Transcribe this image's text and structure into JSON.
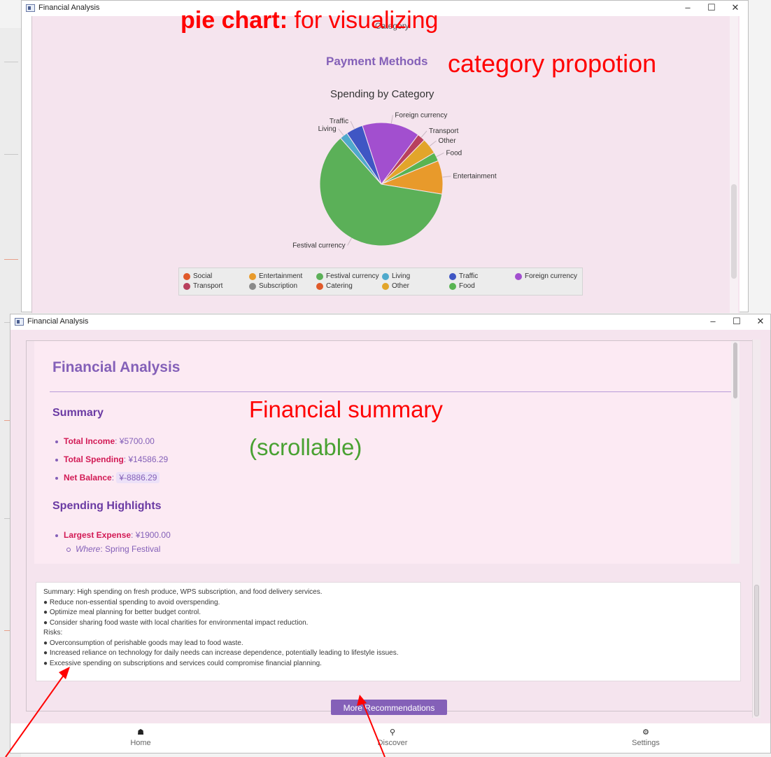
{
  "window1": {
    "title": "Financial Analysis",
    "minimize": "–",
    "maximize": "☐",
    "close": "✕",
    "cut_label": "Category",
    "payment_methods": "Payment Methods"
  },
  "annotations": {
    "pie_label": "pie chart:",
    "pie_desc": " for visualizing",
    "pie_desc2": "category propotion",
    "summary_a": "Financial summary",
    "summary_b": "(scrollable)"
  },
  "chart_data": {
    "type": "pie",
    "title": "Spending by Category",
    "slices": [
      {
        "label": "Foreign currency",
        "value": 1900,
        "color": "#a24fcf"
      },
      {
        "label": "Transport",
        "value": 260,
        "color": "#b8405e"
      },
      {
        "label": "Other",
        "value": 520,
        "color": "#e2a52a"
      },
      {
        "label": "Food",
        "value": 290,
        "color": "#58b452"
      },
      {
        "label": "Entertainment",
        "value": 1100,
        "color": "#e89a2b"
      },
      {
        "label": "Festival currency",
        "value": 7600,
        "color": "#5bb058"
      },
      {
        "label": "Living",
        "value": 260,
        "color": "#4fa9cc"
      },
      {
        "label": "Traffic",
        "value": 556,
        "color": "#3f56c4"
      }
    ],
    "legend": [
      {
        "label": "Social",
        "color": "#e05a2a"
      },
      {
        "label": "Entertainment",
        "color": "#e89a2b"
      },
      {
        "label": "Festival currency",
        "color": "#5bb058"
      },
      {
        "label": "Living",
        "color": "#4fa9cc"
      },
      {
        "label": "Traffic",
        "color": "#3f56c4"
      },
      {
        "label": "Foreign currency",
        "color": "#a24fcf"
      },
      {
        "label": "Transport",
        "color": "#b8405e"
      },
      {
        "label": "Subscription",
        "color": "#8a8a8a"
      },
      {
        "label": "Catering",
        "color": "#e05a2a"
      },
      {
        "label": "Other",
        "color": "#e2a52a"
      },
      {
        "label": "Food",
        "color": "#58b452"
      }
    ]
  },
  "window2": {
    "title": "Financial Analysis",
    "minimize": "–",
    "maximize": "☐",
    "close": "✕"
  },
  "report": {
    "title": "Financial Analysis",
    "summary_heading": "Summary",
    "income_label": "Total Income",
    "income_value": ": ¥5700.00",
    "spending_label": "Total Spending",
    "spending_value": ": ¥14586.29",
    "net_label": "Net Balance",
    "net_sep": ": ",
    "net_value": "¥-8886.29",
    "highlights_heading": "Spending Highlights",
    "largest_label": "Largest Expense",
    "largest_value": ": ¥1900.00",
    "where_label": "Where",
    "where_value": ": Spring Festival"
  },
  "recommendations": [
    "Summary: High spending on fresh produce, WPS subscription, and food delivery services.",
    "● Reduce non-essential spending to avoid overspending.",
    "● Optimize meal planning for better budget control.",
    "● Consider sharing food waste with local charities for environmental impact reduction.",
    "Risks:",
    "● Overconsumption of perishable goods may lead to food waste.",
    "● Increased reliance on technology for daily needs can increase dependence, potentially leading to lifestyle issues.",
    "● Excessive spending on subscriptions and services could compromise financial planning."
  ],
  "more_button": "More Recommendations",
  "nav": {
    "home_icon": "home-icon",
    "home": "Home",
    "discover_icon": "search-icon",
    "discover": "Discover",
    "settings_icon": "gear-icon",
    "settings": "Settings"
  }
}
